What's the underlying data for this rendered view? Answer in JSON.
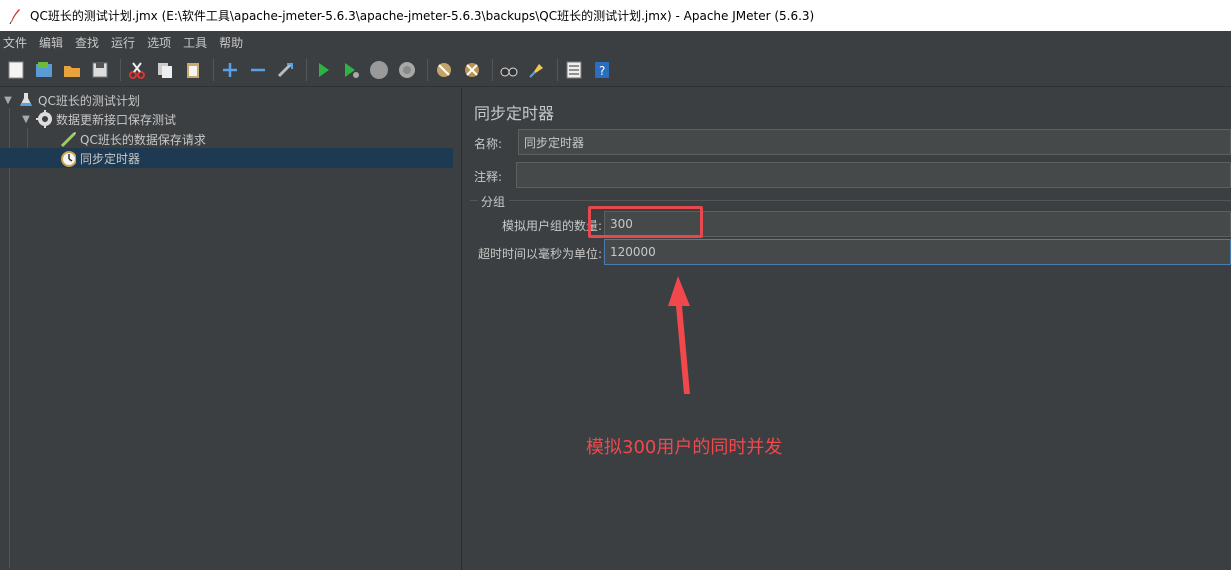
{
  "window": {
    "title": "QC班长的测试计划.jmx (E:\\软件工具\\apache-jmeter-5.6.3\\apache-jmeter-5.6.3\\backups\\QC班长的测试计划.jmx) - Apache JMeter (5.6.3)"
  },
  "menu": [
    "文件",
    "编辑",
    "查找",
    "运行",
    "选项",
    "工具",
    "帮助"
  ],
  "toolbar": {
    "icons": [
      "new-icon",
      "templates-icon",
      "open-icon",
      "save-icon",
      "cut-icon",
      "copy-icon",
      "paste-icon",
      "expand-icon",
      "collapse-icon",
      "toggle-icon",
      "start-icon",
      "start-no-pause-icon",
      "stop-icon",
      "shutdown-icon",
      "clear-icon",
      "clear-all-icon",
      "search-icon",
      "reset-search-icon",
      "function-helper-icon",
      "help-icon"
    ]
  },
  "tree": {
    "items": [
      {
        "label": "QC班长的测试计划",
        "icon": "test-plan-icon",
        "level": 0,
        "expanded": true
      },
      {
        "label": "数据更新接口保存测试",
        "icon": "thread-group-icon",
        "level": 1,
        "expanded": true
      },
      {
        "label": "QC班长的数据保存请求",
        "icon": "sampler-icon",
        "level": 2
      },
      {
        "label": "同步定时器",
        "icon": "timer-icon",
        "level": 2,
        "selected": true
      }
    ]
  },
  "panel": {
    "title": "同步定时器",
    "name_label": "名称:",
    "name_value": "同步定时器",
    "comment_label": "注释:",
    "comment_value": "",
    "group_label": "分组",
    "users_label": "模拟用户组的数量:",
    "users_value": "300",
    "timeout_label": "超时时间以毫秒为单位:",
    "timeout_value": "120000"
  },
  "annotation": {
    "text": "模拟300用户的同时并发",
    "color": "#f0484d"
  }
}
